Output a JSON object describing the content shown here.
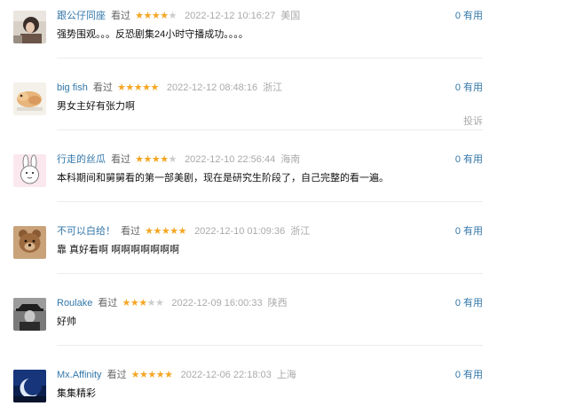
{
  "comments": [
    {
      "user": "跟公仔同座",
      "status": "看过",
      "rating": 4,
      "time": "2022-12-12 10:16:27",
      "location": "美国",
      "text": "强势围观。。。反恐剧集24小时守播成功。。。。",
      "votes": "0 有用"
    },
    {
      "user": "big fish",
      "status": "看过",
      "rating": 5,
      "time": "2022-12-12 08:48:16",
      "location": "浙江",
      "text": "男女主好有张力啊",
      "votes": "0 有用",
      "report": "投诉"
    },
    {
      "user": "行走的丝瓜",
      "status": "看过",
      "rating": 4,
      "time": "2022-12-10 22:56:44",
      "location": "海南",
      "text": "本科期间和舅舅看的第一部美剧，现在是研究生阶段了，自己完整的看一遍。",
      "votes": "0 有用"
    },
    {
      "user": "不可以白给！",
      "status": "看过",
      "rating": 5,
      "time": "2022-12-10 01:09:36",
      "location": "浙江",
      "text": "靠 真好看啊 啊啊啊啊啊啊啊",
      "votes": "0 有用"
    },
    {
      "user": "Roulake",
      "status": "看过",
      "rating": 3,
      "time": "2022-12-09 16:00:33",
      "location": "陕西",
      "text": "好帅",
      "votes": "0 有用"
    },
    {
      "user": "Mx.Affinity",
      "status": "看过",
      "rating": 5,
      "time": "2022-12-06 22:18:03",
      "location": "上海",
      "text": "集集精彩",
      "votes": "0 有用"
    }
  ],
  "colors": {
    "link": "#3377aa",
    "star": "#f5a623",
    "star_empty": "#cccccc",
    "muted": "#aaaaaa"
  },
  "icons": {
    "star_filled": "star-icon",
    "star_empty": "star-empty-icon"
  }
}
